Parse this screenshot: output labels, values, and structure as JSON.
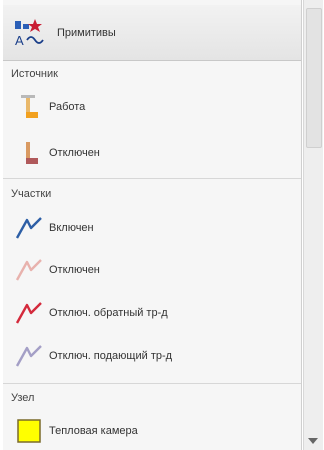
{
  "header": {
    "title": "Примитивы"
  },
  "sections": [
    {
      "title": "Источник",
      "items": [
        {
          "label": "Работа",
          "icon": "source-work-icon",
          "color": "#e3a23a"
        },
        {
          "label": "Отключен",
          "icon": "source-off-icon",
          "color": "#b86a5a"
        }
      ]
    },
    {
      "title": "Участки",
      "items": [
        {
          "label": "Включен",
          "icon": "line-on-icon",
          "color": "#2d5fa6"
        },
        {
          "label": "Отключен",
          "icon": "line-off-icon",
          "color": "#e8b2ad"
        },
        {
          "label": "Отключ. обратный тр-д",
          "icon": "line-return-off-icon",
          "color": "#d42a3c"
        },
        {
          "label": "Отключ. подающий тр-д",
          "icon": "line-supply-off-icon",
          "color": "#a49fc6"
        }
      ]
    },
    {
      "title": "Узел",
      "items": [
        {
          "label": "Тепловая камера",
          "icon": "heat-chamber-icon",
          "color": "#ffff00"
        }
      ]
    }
  ]
}
